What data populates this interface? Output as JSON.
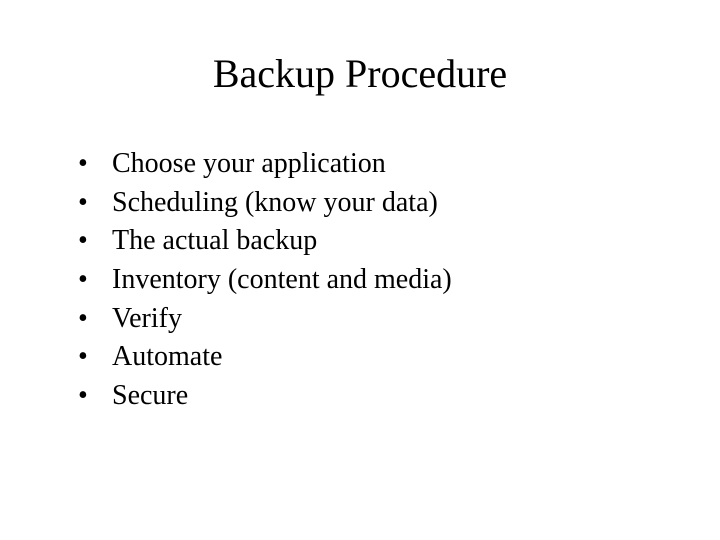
{
  "title": "Backup Procedure",
  "bullets": [
    "Choose your application",
    "Scheduling (know your data)",
    "The actual backup",
    "Inventory (content and media)",
    "Verify",
    "Automate",
    "Secure"
  ]
}
